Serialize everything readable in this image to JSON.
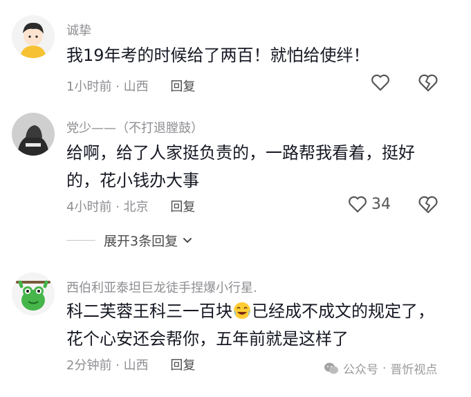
{
  "comments": [
    {
      "username": "诚挚",
      "text": "我19年考的时候给了两百！就怕给使绊！",
      "time": "1小时前",
      "location": "山西",
      "reply_label": "回复",
      "like_count": ""
    },
    {
      "username": "党少——（不打退膛鼓）",
      "text": "给啊，给了人家挺负责的，一路帮我看着，挺好的，花小钱办大事",
      "time": "4小时前",
      "location": "北京",
      "reply_label": "回复",
      "like_count": "34"
    },
    {
      "username": "西伯利亚泰坦巨龙徒手捏爆小行星.",
      "text_before_emoji": "科二芙蓉王科三一百块",
      "text_after_emoji": "已经成不成文的规定了，花个心安还会帮你，五年前就是这样了",
      "time": "2分钟前",
      "location": "山西",
      "reply_label": "回复",
      "like_count": ""
    }
  ],
  "expand_replies": "展开3条回复",
  "watermark": {
    "platform": "公众号",
    "separator": "·",
    "account": "晋忻视点"
  },
  "icons": {
    "like": "heart-outline-icon",
    "dislike": "broken-heart-icon",
    "expand": "chevron-down-icon",
    "wechat": "wechat-logo-icon"
  },
  "colors": {
    "text": "#161823",
    "muted": "#8e8e93"
  }
}
